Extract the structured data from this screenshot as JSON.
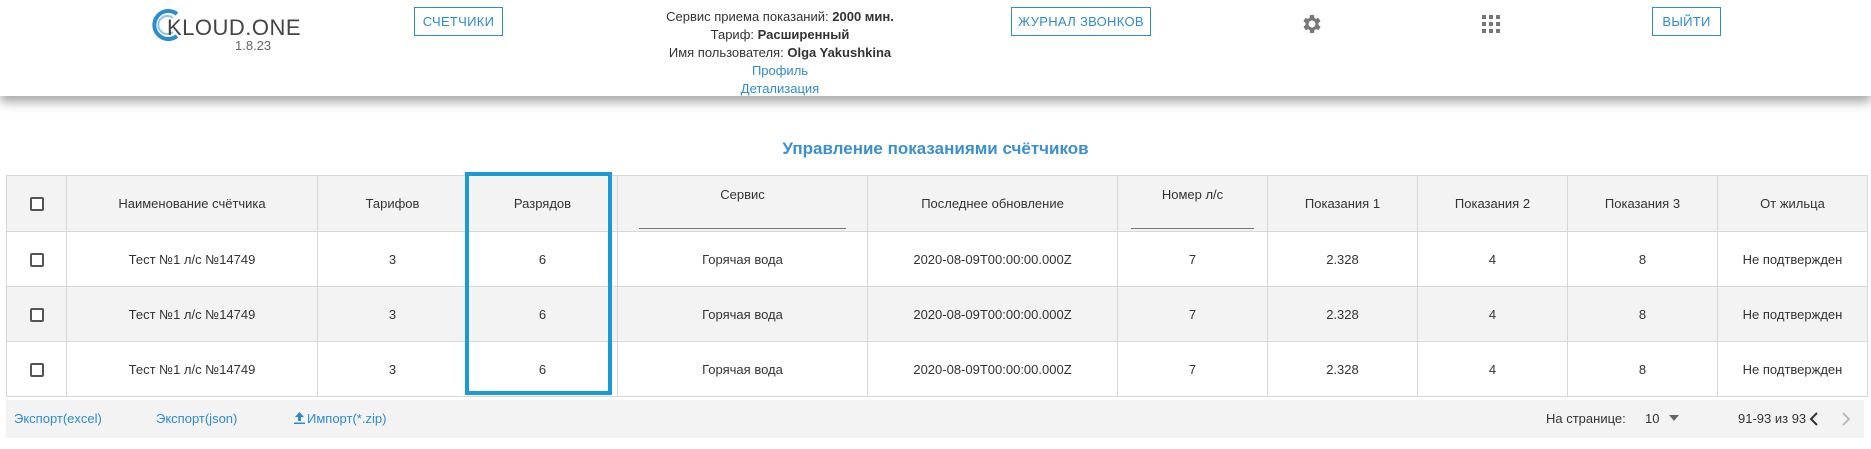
{
  "brand": {
    "name": "KLOUD.ONE",
    "version": "1.8.23",
    "accent": "#2e8bd0"
  },
  "header": {
    "meters_button": "СЧЕТЧИКИ",
    "calls_button": "ЖУРНАЛ ЗВОНКОВ",
    "logout_button": "ВЫЙТИ",
    "service_label": "Сервис приема показаний:",
    "service_value": "2000 мин.",
    "tariff_label": "Тариф:",
    "tariff_value": "Расширенный",
    "user_label": "Имя пользователя:",
    "user_value": "Olga Yakushkina",
    "profile_link": "Профиль",
    "details_link": "Детализация",
    "settings_icon": "gear-icon",
    "apps_icon": "grid-icon"
  },
  "page": {
    "title": "Управление показаниями счётчиков",
    "highlight_color": "#1a9ad6"
  },
  "table": {
    "columns": [
      "Наименование счётчика",
      "Тарифов",
      "Разрядов",
      "Сервис",
      "Последнее обновление",
      "Номер л/с",
      "Показания 1",
      "Показания 2",
      "Показания 3",
      "От жильца"
    ],
    "rows": [
      [
        "Тест №1 л/с №14749",
        "3",
        "6",
        "Горячая вода",
        "2020-08-09T00:00:00.000Z",
        "7",
        "2.328",
        "4",
        "8",
        "Не подтвержден"
      ],
      [
        "Тест №1 л/с №14749",
        "3",
        "6",
        "Горячая вода",
        "2020-08-09T00:00:00.000Z",
        "7",
        "2.328",
        "4",
        "8",
        "Не подтвержден"
      ],
      [
        "Тест №1 л/с №14749",
        "3",
        "6",
        "Горячая вода",
        "2020-08-09T00:00:00.000Z",
        "7",
        "2.328",
        "4",
        "8",
        "Не подтвержден"
      ]
    ]
  },
  "footer": {
    "export_excel": "Экспорт(excel)",
    "export_json": "Экспорт(json)",
    "import_zip": "Импорт(*.zip)",
    "per_page_label": "На странице:",
    "per_page_value": "10",
    "range": "91-93 из 93"
  }
}
